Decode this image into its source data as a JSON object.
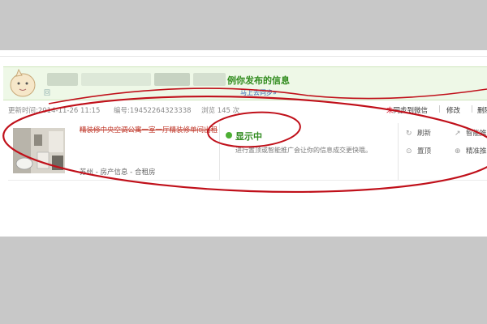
{
  "banner": {
    "title": "例你发布的信息",
    "sub_prefix": "回",
    "share_link": "马上去同步»"
  },
  "meta": {
    "update_time": "更新时间:2014-11-26 11:15",
    "listing_no": "编号:19452264323338",
    "views": "浏览 145 次",
    "sync_prefix": "未",
    "sync_label": "同步到微信",
    "separator": "|",
    "edit": "修改",
    "delete": "删除"
  },
  "listing": {
    "title": "精装修中央空调公寓一室一厅精装修单间出租",
    "location": "苏州 - 房产信息 - 合租房",
    "status": "显示中",
    "status_hint": "进行置顶或智能推广会让你的信息成交更快哦。",
    "actions": {
      "refresh": "刷新",
      "top": "置顶",
      "smart": "智能推",
      "precise": "精准推"
    }
  },
  "colors": {
    "status_green": "#2f8a1e",
    "annotation_red": "#c0101a",
    "banner_bg": "#eef8e7"
  },
  "icons": {
    "refresh": "refresh-icon",
    "top": "pin-icon",
    "smart": "smart-promote-icon",
    "precise": "target-icon"
  }
}
